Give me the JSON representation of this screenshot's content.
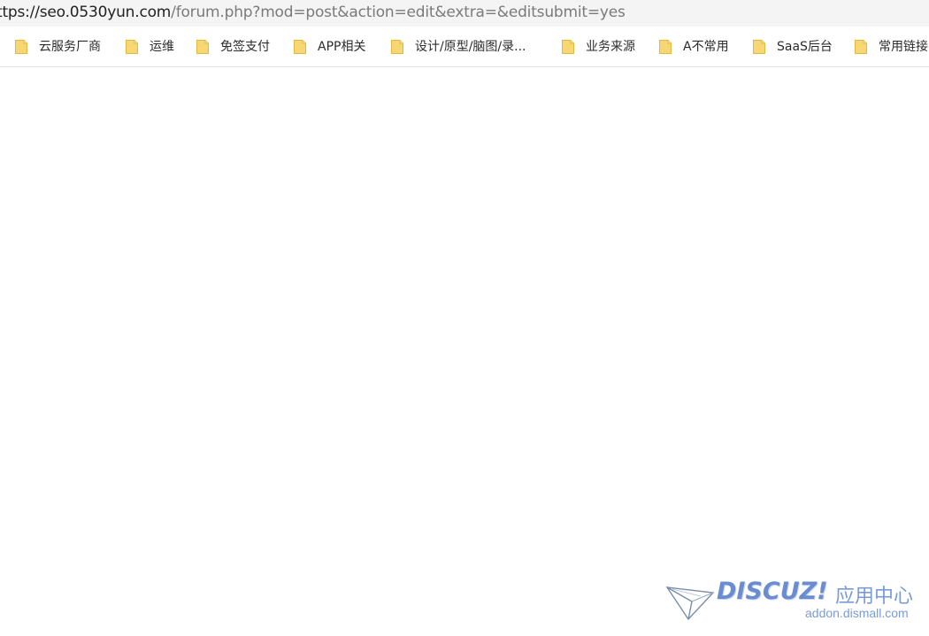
{
  "address_bar": {
    "url_host": "ttps://seo.0530yun.com",
    "url_path": "/forum.php?mod=post&action=edit&extra=&editsubmit=yes"
  },
  "bookmarks": [
    {
      "label": "云服务厂商",
      "icon": "folder-icon"
    },
    {
      "label": "运维",
      "icon": "folder-icon"
    },
    {
      "label": "免签支付",
      "icon": "folder-icon"
    },
    {
      "label": "APP相关",
      "icon": "folder-icon"
    },
    {
      "label": "设计/原型/脑图/录...",
      "icon": "folder-icon"
    },
    {
      "label": "业务来源",
      "icon": "folder-icon"
    },
    {
      "label": "A不常用",
      "icon": "folder-icon"
    },
    {
      "label": "SaaS后台",
      "icon": "folder-icon"
    },
    {
      "label": "常用链接",
      "icon": "folder-icon"
    }
  ],
  "watermark": {
    "brand": "DISCUZ!",
    "center_label": "应用中心",
    "domain": "addon.dismall.com"
  },
  "colors": {
    "folder": "#f7d774",
    "folder_border": "#e2b93f",
    "watermark": "#6b8ccf"
  }
}
